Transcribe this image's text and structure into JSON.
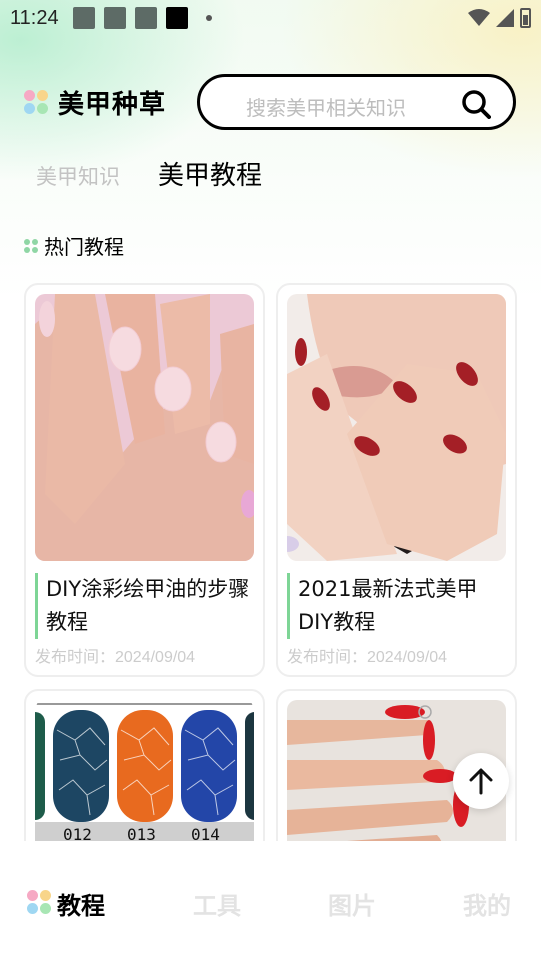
{
  "status_bar": {
    "time": "11:24"
  },
  "header": {
    "app_title": "美甲种草",
    "search_placeholder": "搜索美甲相关知识"
  },
  "tabs": [
    {
      "label": "美甲知识",
      "active": false
    },
    {
      "label": "美甲教程",
      "active": true
    }
  ],
  "section": {
    "title": "热门教程"
  },
  "cards": [
    {
      "title": "DIY涂彩绘甲油的步骤教程",
      "date": "发布时间：2024/09/04"
    },
    {
      "title": "2021最新法式美甲DIY教程",
      "date": "发布时间：2024/09/04"
    },
    {
      "title": "",
      "date": "",
      "image_labels": [
        "012",
        "013",
        "014"
      ]
    },
    {
      "title": "",
      "date": ""
    }
  ],
  "bottom_nav": [
    {
      "label": "教程",
      "active": true
    },
    {
      "label": "工具",
      "active": false
    },
    {
      "label": "图片",
      "active": false
    },
    {
      "label": "我的",
      "active": false
    }
  ],
  "colors": {
    "accent_green": "#7ed596",
    "nail_red": "#b3262c",
    "inactive_text": "#c3c3c3"
  },
  "icons": [
    "search-icon",
    "arrow-up-icon",
    "wifi-icon",
    "signal-icon",
    "battery-icon"
  ]
}
